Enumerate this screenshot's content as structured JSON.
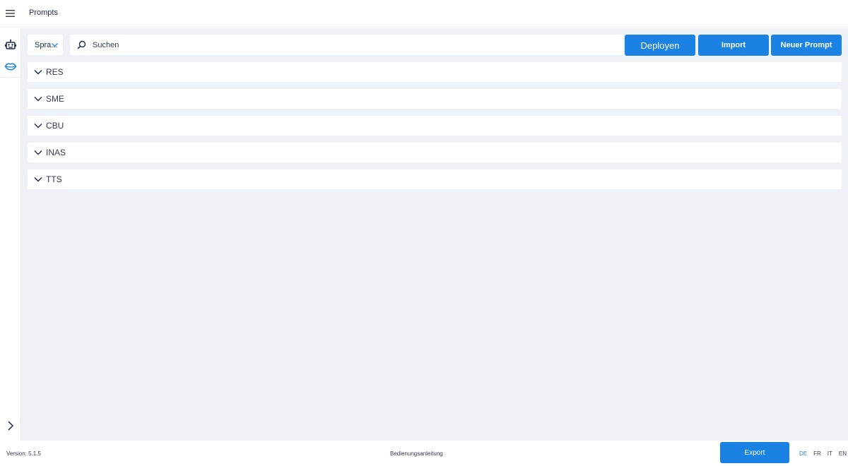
{
  "header": {
    "title": "Prompts",
    "menu_icon": "hamburger-icon"
  },
  "sidebar": {
    "items": [
      {
        "icon": "robot-icon"
      },
      {
        "icon": "lips-icon"
      }
    ],
    "expand_icon": "chevron-right-icon"
  },
  "toolbar": {
    "language_select": {
      "value": "Spra...",
      "icon": "chevron-down-icon"
    },
    "search": {
      "placeholder": "Suchen",
      "value": "",
      "icon": "search-icon"
    },
    "deploy_label": "Deployen",
    "import_label": "Import",
    "new_prompt_label": "Neuer Prompt"
  },
  "groups": [
    {
      "label": "RES"
    },
    {
      "label": "SME"
    },
    {
      "label": "CBU"
    },
    {
      "label": "INAS"
    },
    {
      "label": "TTS"
    }
  ],
  "footer": {
    "version": "Version: 5.1.5",
    "manual": "Bedienungsanleitung",
    "export_label": "Export",
    "languages": [
      "DE",
      "FR",
      "IT",
      "EN"
    ],
    "active_language": "DE"
  },
  "colors": {
    "accent": "#1a82e2",
    "text": "#1d2a52",
    "background": "#eef2f6",
    "icon_lips": "#1a82e2"
  }
}
